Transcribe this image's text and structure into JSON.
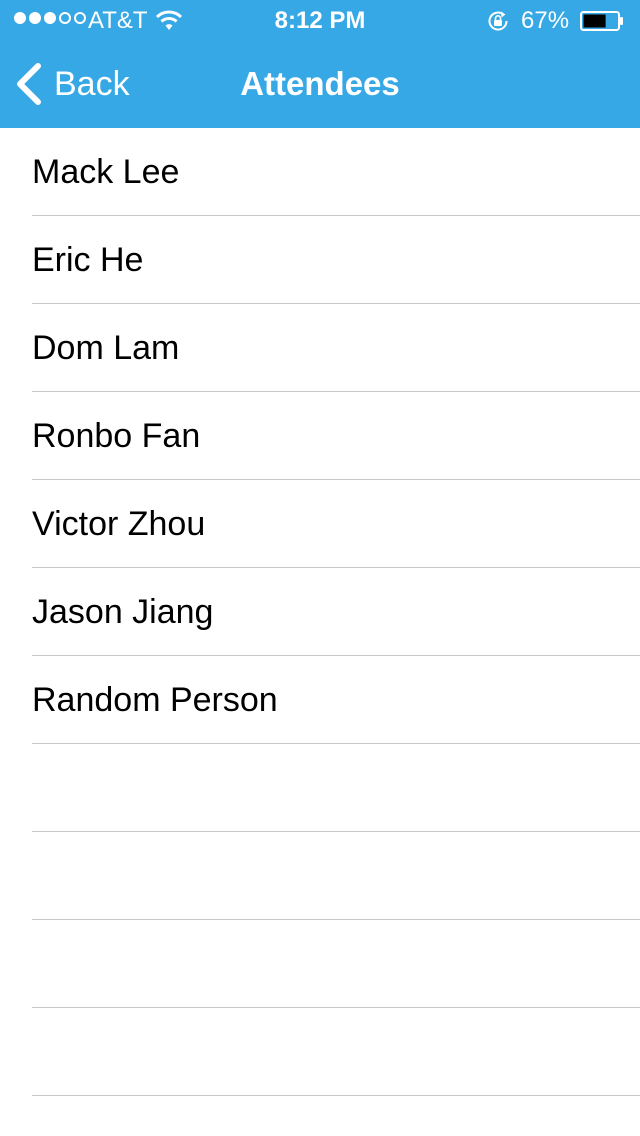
{
  "status_bar": {
    "carrier": "AT&T",
    "time": "8:12 PM",
    "battery_percent": "67%",
    "signal_bars_filled": 3,
    "signal_bars_total": 5,
    "battery_level": 0.67,
    "icons": [
      "signal-dots-icon",
      "wifi-icon",
      "rotation-lock-icon",
      "battery-icon"
    ]
  },
  "nav": {
    "back_label": "Back",
    "title": "Attendees",
    "back_icon": "chevron-left-icon"
  },
  "attendees": [
    "Mack Lee",
    "Eric He",
    "Dom Lam",
    "Ronbo Fan",
    "Victor Zhou",
    "Jason Jiang",
    "Random Person"
  ],
  "empty_rows": 4,
  "colors": {
    "bar_background": "#37a8e6",
    "bar_text": "#ffffff",
    "separator": "#c8c7cc",
    "row_text": "#000000"
  }
}
